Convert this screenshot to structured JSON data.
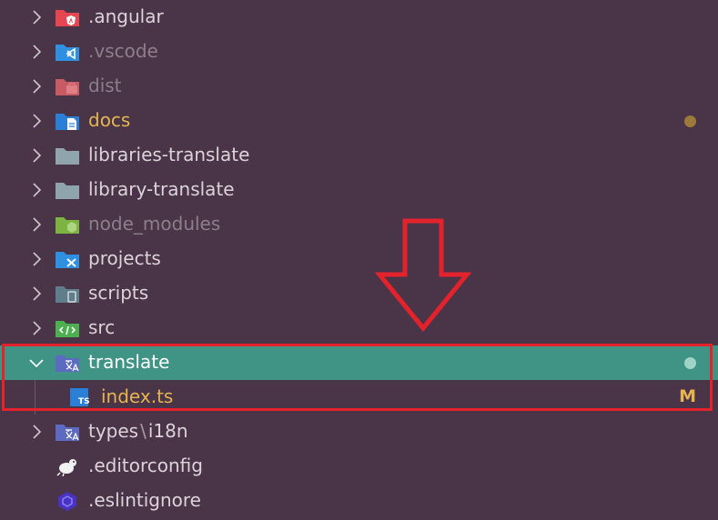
{
  "explorer": {
    "items": [
      {
        "label": ".angular",
        "icon": "angular-folder-icon",
        "state": "collapsed"
      },
      {
        "label": ".vscode",
        "icon": "vscode-folder-icon",
        "state": "collapsed"
      },
      {
        "label": "dist",
        "icon": "dist-folder-icon",
        "state": "collapsed"
      },
      {
        "label": "docs",
        "icon": "docs-folder-icon",
        "state": "collapsed",
        "status_dot_color": "#9c7a3c"
      },
      {
        "label": "libraries-translate",
        "icon": "folder-icon",
        "state": "collapsed"
      },
      {
        "label": "library-translate",
        "icon": "folder-icon",
        "state": "collapsed"
      },
      {
        "label": "node_modules",
        "icon": "node-folder-icon",
        "state": "collapsed"
      },
      {
        "label": "projects",
        "icon": "projects-folder-icon",
        "state": "collapsed"
      },
      {
        "label": "scripts",
        "icon": "scripts-folder-icon",
        "state": "collapsed"
      },
      {
        "label": "src",
        "icon": "src-folder-icon",
        "state": "collapsed"
      },
      {
        "label": "translate",
        "icon": "translate-folder-icon",
        "state": "expanded",
        "status_dot_color": "#9fd3c7"
      },
      {
        "label": "index.ts",
        "icon": "typescript-file-icon",
        "git_status": "M"
      },
      {
        "label_part1": "types",
        "separator": "\\",
        "label_part2": "i18n",
        "icon": "translate-folder-icon",
        "state": "collapsed"
      },
      {
        "label": ".editorconfig",
        "icon": "editorconfig-file-icon"
      },
      {
        "label": ".eslintignore",
        "icon": "eslint-file-icon"
      }
    ]
  },
  "colors": {
    "background": "#4a3548",
    "selected_row": "#3f9486",
    "highlight_box": "#e3222b",
    "modified_text": "#e6b450"
  }
}
